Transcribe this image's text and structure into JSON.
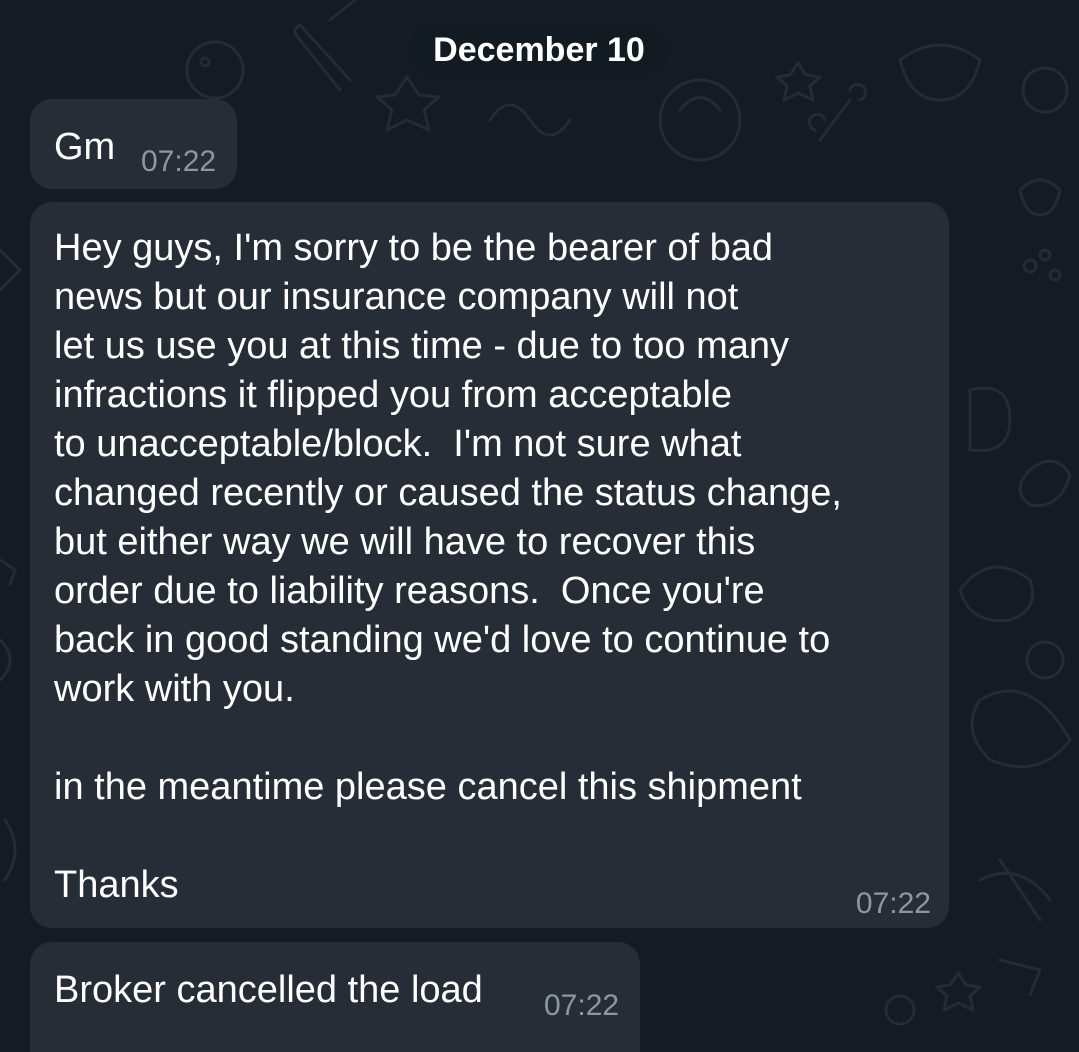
{
  "chat": {
    "date_separator": "December 10",
    "messages": [
      {
        "text": "Gm",
        "time": "07:22"
      },
      {
        "text": "Hey guys, I'm sorry to be the bearer of bad\nnews but our insurance company will not\nlet us use you at this time - due to too many\ninfractions it flipped you from acceptable\nto unacceptable/block.  I'm not sure what\nchanged recently or caused the status change,\nbut either way we will have to recover this\norder due to liability reasons.  Once you're\nback in good standing we'd love to continue to\nwork with you.\n\nin the meantime please cancel this shipment\n\nThanks",
        "time": "07:22"
      },
      {
        "text": "Broker cancelled the load",
        "time": "07:22"
      }
    ]
  },
  "theme": {
    "background": "#151b22",
    "bubble": "#262d37",
    "text": "#ffffff",
    "timestamp": "#8b97a5",
    "doodle": "#232b35"
  }
}
